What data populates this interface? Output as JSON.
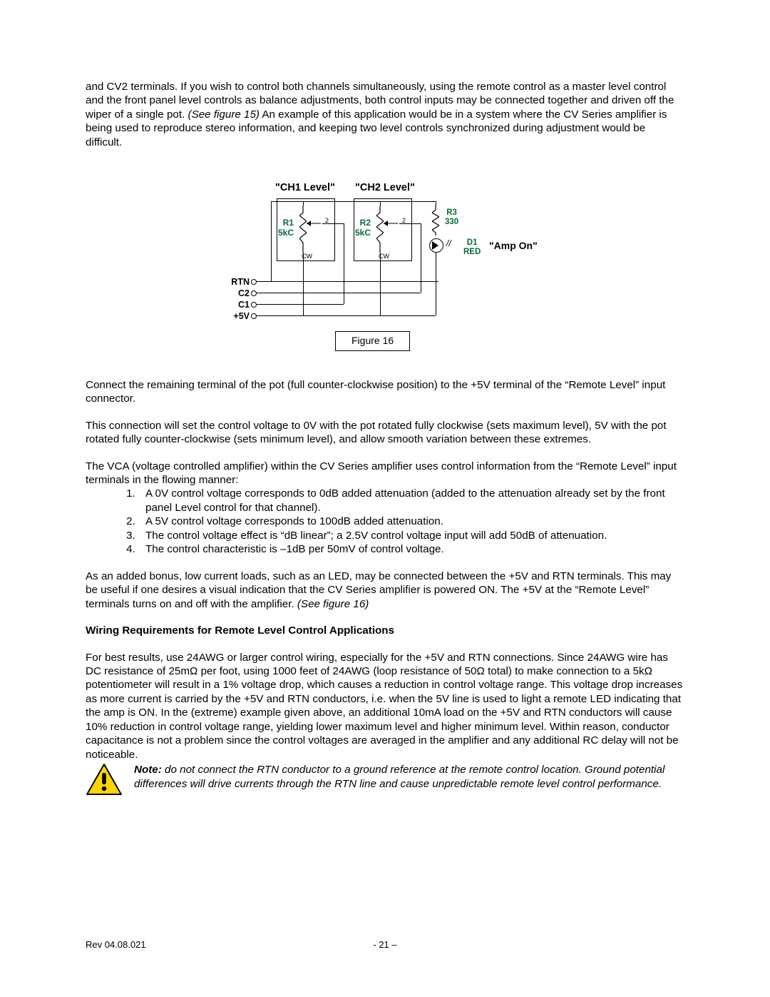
{
  "intro": "and CV2 terminals.  If you wish to control both channels simultaneously, using the remote control as a master level control and the front panel level controls as balance adjustments, both control inputs may be connected together and driven off the wiper of a single pot.  ",
  "intro_ref": "(See figure 15)",
  "intro_tail": "  An example of this application would be in a system where the CV Series amplifier is being used to reproduce stereo information, and keeping two level controls synchronized during adjustment would be difficult.",
  "figure": {
    "ch1": "\"CH1 Level\"",
    "ch2": "\"CH2 Level\"",
    "r1_a": "R1",
    "r1_b": "5kC",
    "r2_a": "R2",
    "r2_b": "5kC",
    "r3_a": "R3",
    "r3_b": "330",
    "d1_a": "D1",
    "d1_b": "RED",
    "amp_on": "\"Amp On\"",
    "term_rtn": "RTN",
    "term_c2": "C2",
    "term_c1": "C1",
    "term_5v": "+5V",
    "pin2": "2",
    "cw": "CW",
    "caption": "Figure 16"
  },
  "p1": "Connect the remaining terminal of the pot (full counter-clockwise position) to the +5V terminal of the “Remote Level” input connector.",
  "p2": "This connection will set the control voltage to 0V with the pot rotated fully clockwise (sets maximum level), 5V with the pot rotated fully counter-clockwise (sets minimum level), and allow smooth variation between these extremes.",
  "p3_lead": "The VCA (voltage controlled amplifier) within the CV Series amplifier uses control information from the “Remote Level” input terminals in the flowing manner:",
  "list": [
    "A 0V control voltage corresponds to 0dB added attenuation (added to the attenuation already set by the front panel Level control for that channel).",
    "A 5V control voltage corresponds to 100dB added attenuation.",
    "The control voltage effect is “dB linear”; a 2.5V control voltage input will add 50dB of attenuation.",
    "The control characteristic is –1dB per 50mV of control voltage."
  ],
  "p4a": "As an added bonus, low current loads, such as an LED, may be connected between the +5V and RTN terminals.  This may be useful if one desires a visual indication that the CV Series amplifier is powered ON.  The +5V at the “Remote Level” terminals turns on and off with the amplifier. ",
  "p4ref": "(See figure 16)",
  "section": "Wiring Requirements for Remote Level Control Applications",
  "p5": "For best results, use 24AWG or larger control wiring, especially for the +5V and RTN connections.  Since 24AWG wire has DC resistance of 25mΩ per foot, using 1000 feet of 24AWG (loop resistance of 50Ω total) to make connection to a 5kΩ potentiometer will result in a 1% voltage drop, which causes a reduction in control voltage range.  This voltage drop increases as more current is carried by the +5V and RTN conductors, i.e. when the 5V line is used to light a remote LED indicating that the amp is ON.  In the (extreme) example given above, an additional 10mA load on the +5V and RTN conductors will cause 10% reduction in control voltage range, yielding lower maximum level and higher minimum level.  Within reason, conductor capacitance is not a problem since the control voltages are averaged in the amplifier and any additional RC delay will not be noticeable.",
  "note_label": "Note:",
  "note_body": " do not connect the RTN conductor to a ground reference at the remote control location.  Ground potential differences will drive currents through the RTN line and cause unpredictable remote level control performance.",
  "footer_left": "Rev 04.08.021",
  "footer_center": "- 21 –"
}
